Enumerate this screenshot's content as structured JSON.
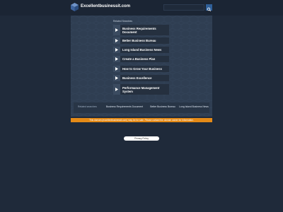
{
  "header": {
    "site_name": "Excellentbusinessit.com",
    "logo_icon": "cube-logo-icon",
    "search_placeholder": "",
    "search_icon": "search-icon"
  },
  "panel": {
    "related_label": "Related Searches",
    "links": [
      {
        "label": "Business Requirements Document",
        "icon": "arrow-right-icon"
      },
      {
        "label": "Better Business Bureau",
        "icon": "arrow-right-icon"
      },
      {
        "label": "Long Island Business News",
        "icon": "arrow-right-icon"
      },
      {
        "label": "Create a Business Plan",
        "icon": "arrow-right-icon"
      },
      {
        "label": "How to Grow Your Business",
        "icon": "arrow-right-icon"
      },
      {
        "label": "Business Excellence",
        "icon": "arrow-right-icon"
      },
      {
        "label": "Performance Management System",
        "icon": "arrow-right-icon"
      }
    ]
  },
  "bottom_links": {
    "label": "Related searches:",
    "items": [
      "Business Requirements Document",
      "Better Business Bureau",
      "Long Island Business News"
    ]
  },
  "notice": {
    "text": "This domain (excellentbusinessit.com) may be for sale. Please contact the domain owner for information."
  },
  "privacy": {
    "label": "Privacy Policy"
  },
  "colors": {
    "background": "#1f2a3a",
    "panel": "#2f3e52",
    "notice": "#e48a17",
    "accent": "#2f5f98"
  }
}
